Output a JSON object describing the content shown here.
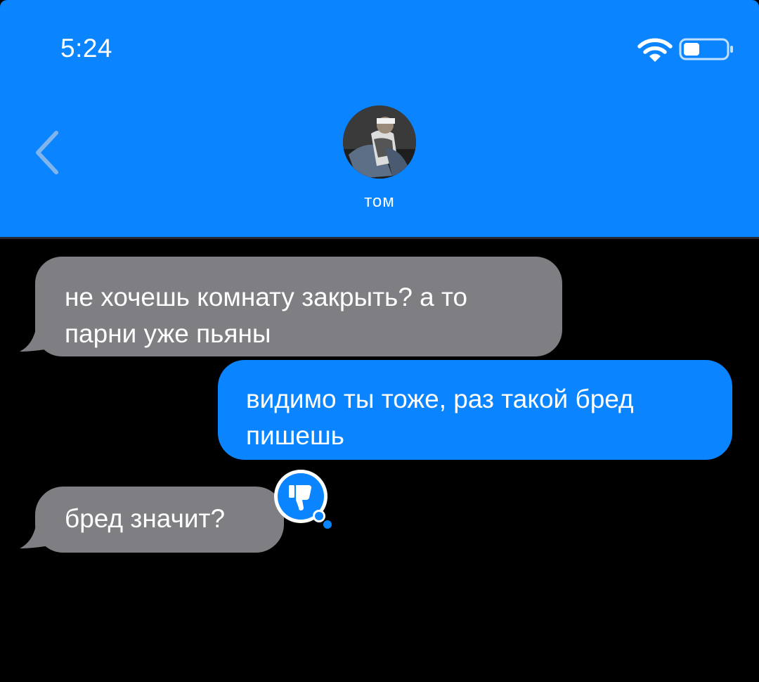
{
  "status_bar": {
    "time": "5:24",
    "wifi_icon": "wifi-icon",
    "battery_icon": "battery-icon"
  },
  "header": {
    "back_icon": "chevron-left-icon",
    "contact_name": "том",
    "background_color": "#0A84FF"
  },
  "messages": [
    {
      "direction": "incoming",
      "lines": [
        "не хочешь комнату закрыть? а то",
        "парни уже пьяны"
      ],
      "color": "#7F7F83"
    },
    {
      "direction": "outgoing",
      "lines": [
        "видимо ты тоже, раз такой бред",
        "пишешь"
      ],
      "color": "#0A84FF"
    },
    {
      "direction": "incoming",
      "lines": [
        "бред значит?"
      ],
      "color": "#7F7F83",
      "reaction": "thumbs-down-icon"
    }
  ]
}
